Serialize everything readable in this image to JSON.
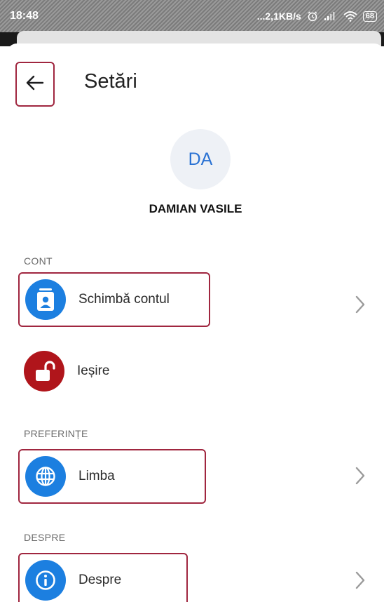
{
  "status_bar": {
    "time": "18:48",
    "net_speed": "...2,1KB/s",
    "battery": "68",
    "icons": [
      "alarm-icon",
      "signal-icon",
      "wifi-icon",
      "battery-icon"
    ]
  },
  "header": {
    "back_icon": "arrow-left-icon",
    "title": "Setări"
  },
  "profile": {
    "initials": "DA",
    "name": "DAMIAN VASILE"
  },
  "sections": {
    "account": {
      "label": "CONT",
      "items": [
        {
          "label": "Schimbă contul",
          "icon": "account-switch-icon"
        },
        {
          "label": "Ieșire",
          "icon": "unlock-icon"
        }
      ]
    },
    "preferences": {
      "label": "PREFERINȚE",
      "items": [
        {
          "label": "Limba",
          "icon": "globe-icon"
        }
      ]
    },
    "about": {
      "label": "DESPRE",
      "items": [
        {
          "label": "Despre",
          "icon": "info-icon"
        }
      ]
    }
  },
  "colors": {
    "accent_blue": "#1c7fe0",
    "logout_red": "#b0151b",
    "highlight_border": "#a0263f"
  }
}
